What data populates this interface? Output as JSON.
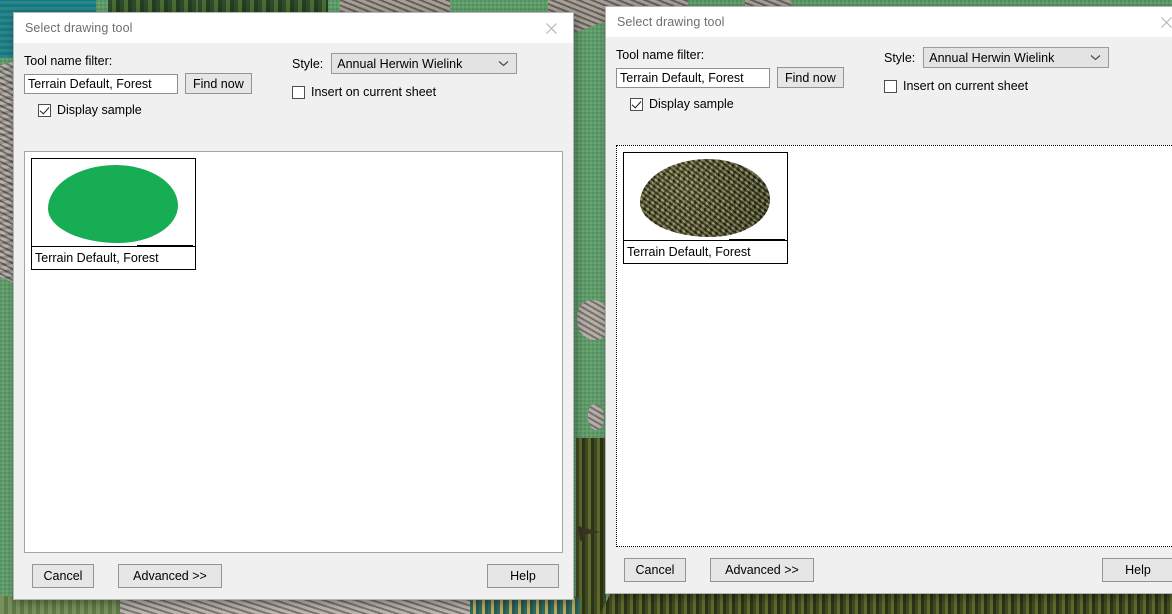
{
  "background": {
    "description": "tiled fantasy map canvas behind the dialogs"
  },
  "dialogs": [
    {
      "id": "left",
      "title": "Select drawing tool",
      "close_icon": "close-icon",
      "filter": {
        "label": "Tool name filter:",
        "value": "Terrain Default, Forest",
        "placeholder": "",
        "find_button": "Find now"
      },
      "style": {
        "label": "Style:",
        "selected": "Annual Herwin Wielink",
        "arrow_icon": "chevron-down-icon"
      },
      "insert_checkbox": {
        "label": "Insert on current sheet",
        "checked": false
      },
      "display_sample_checkbox": {
        "label": "Display sample",
        "checked": true
      },
      "sample": {
        "label": "Terrain Default, Forest",
        "swatch": "solid-green-blob",
        "color": "#16ad55"
      },
      "list_focused": false,
      "footer": {
        "cancel": "Cancel",
        "advanced": "Advanced >>",
        "help": "Help"
      }
    },
    {
      "id": "right",
      "title": "Select drawing tool",
      "close_icon": "close-icon",
      "filter": {
        "label": "Tool name filter:",
        "value": "Terrain Default, Forest",
        "placeholder": "",
        "find_button": "Find now"
      },
      "style": {
        "label": "Style:",
        "selected": "Annual Herwin Wielink",
        "arrow_icon": "chevron-down-icon"
      },
      "insert_checkbox": {
        "label": "Insert on current sheet",
        "checked": false
      },
      "display_sample_checkbox": {
        "label": "Display sample",
        "checked": true
      },
      "sample": {
        "label": "Terrain Default, Forest",
        "swatch": "textured-forest-blob",
        "color": "#6b6a2e"
      },
      "list_focused": true,
      "footer": {
        "cancel": "Cancel",
        "advanced": "Advanced >>",
        "help": "Help"
      }
    }
  ]
}
